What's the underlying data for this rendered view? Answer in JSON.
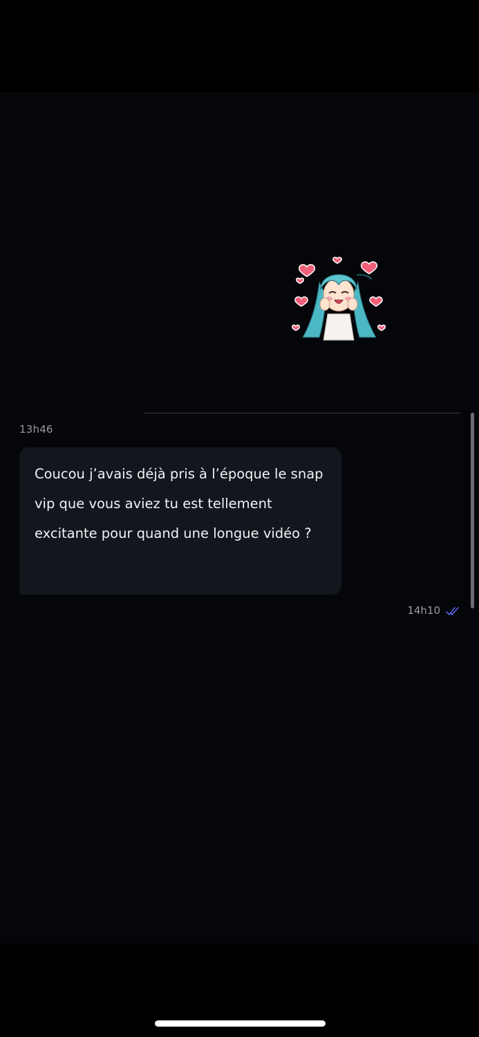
{
  "conversation": {
    "sticker": {
      "icon": "anime-girl-hearts-sticker"
    },
    "incoming_message": {
      "timestamp": "13h46",
      "text": "Coucou j’avais déjà pris à l’époque le snap vip que vous aviez tu est tellement excitante pour quand une longue vidéo ?"
    },
    "outgoing_status": {
      "timestamp": "14h10",
      "read_icon": "double-check-icon",
      "read_color": "#5b67f1"
    }
  },
  "colors": {
    "background": "#05060a",
    "bubble": "#14161e",
    "text": "#f1f2f5",
    "muted_text": "#9a9ca3"
  }
}
